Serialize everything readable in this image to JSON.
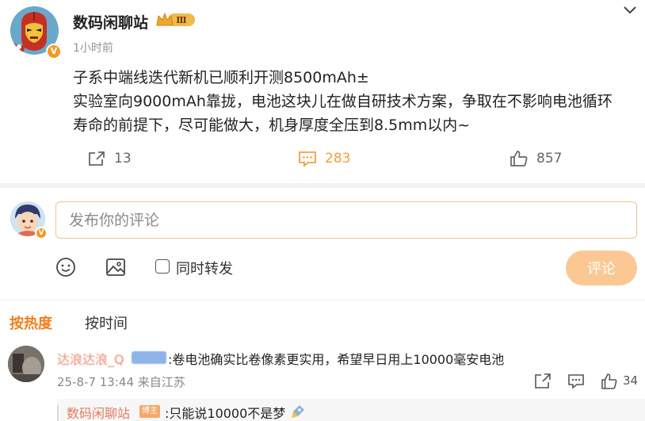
{
  "post": {
    "author": "数码闲聊站",
    "level_badge": "Ⅲ",
    "verified_mark": "V",
    "time": "1小时前",
    "text_lines": [
      "子系中端线迭代新机已顺利开测8500mAh±",
      "实验室向9000mAh靠拢，电池这块儿在做自研技术方案，争取在不影响电池循环",
      "寿命的前提下，尽可能做大，机身厚度全压到8.5mm以内~"
    ],
    "actions": {
      "share_count": "13",
      "comment_count": "283",
      "like_count": "857"
    }
  },
  "composer": {
    "placeholder": "发布你的评论",
    "repost_label": "同时转发",
    "submit_label": "评论",
    "verified_mark": "V"
  },
  "sort": {
    "hot_label": "按热度",
    "time_label": "按时间"
  },
  "comment": {
    "username": "达浪达浪_Q",
    "text": ":卷电池确实比卷像素更实用，希望早日用上10000毫安电池",
    "meta": "25-8-7 13:44 来自江苏",
    "like_count": "34",
    "reply": {
      "author": "数码闲聊站",
      "tag": "博主",
      "text": ":只能说10000不是梦"
    }
  },
  "colors": {
    "accent": "#f27e1a",
    "comment_accent": "#f2a03c",
    "button": "#fbc894",
    "input_border": "#f0c48c",
    "verified": "#f29a24"
  },
  "icons": [
    "iron-man-avatar",
    "crown-icon",
    "chevron-down-icon",
    "share-icon",
    "comment-icon",
    "thumbs-up-icon",
    "emoji-icon",
    "image-icon",
    "rocket-icon"
  ]
}
